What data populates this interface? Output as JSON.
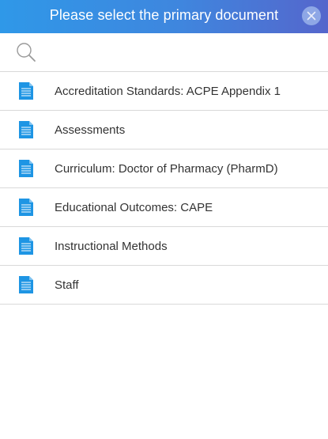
{
  "header": {
    "title": "Please select the primary document",
    "close_icon": "close-icon"
  },
  "search": {
    "icon": "search-icon",
    "value": "",
    "placeholder": ""
  },
  "documents": [
    {
      "label": "Accreditation Standards: ACPE Appendix 1",
      "icon": "document-icon"
    },
    {
      "label": "Assessments",
      "icon": "document-icon"
    },
    {
      "label": "Curriculum: Doctor of Pharmacy (PharmD)",
      "icon": "document-icon"
    },
    {
      "label": "Educational Outcomes: CAPE",
      "icon": "document-icon"
    },
    {
      "label": "Instructional Methods",
      "icon": "document-icon"
    },
    {
      "label": "Staff",
      "icon": "document-icon"
    }
  ],
  "colors": {
    "header_start": "#2f98e8",
    "header_end": "#5566cc",
    "doc_icon": "#1e95e4",
    "text": "#333333",
    "divider": "#d9d9d9"
  }
}
